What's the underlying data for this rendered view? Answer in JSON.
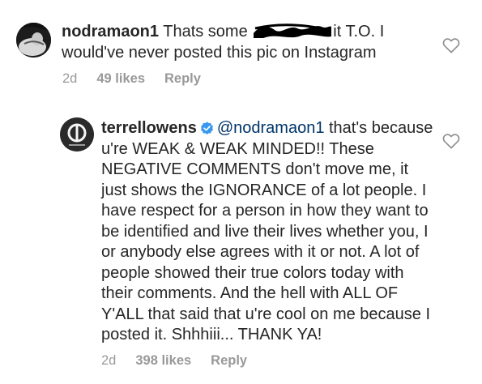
{
  "comments": [
    {
      "username": "nodramaon1",
      "text_before_redaction": "Thats some ",
      "text_after_redaction": "it T.O. I would've never posted this pic on Instagram",
      "time": "2d",
      "likes": "49 likes",
      "reply_label": "Reply",
      "like_icon": "heart-outline-icon"
    },
    {
      "username": "terrellowens",
      "verified": true,
      "verified_color": "#3897f0",
      "mention": "@nodramaon1",
      "text": " that's because u're WEAK & WEAK MINDED!! These NEGATIVE COMMENTS don't move me, it just shows the IGNORANCE of a lot people. I have respect for a person in how they want to be identified and live their lives whether you, I or anybody else agrees with it or not. A lot of people showed their true colors today with their comments. And the hell with ALL OF Y'ALL that said that u're cool on me because I posted it. Shhhiii... THANK YA!",
      "time": "2d",
      "likes": "398 likes",
      "reply_label": "Reply",
      "like_icon": "heart-outline-icon"
    }
  ],
  "colors": {
    "text": "#262626",
    "meta": "#999999",
    "mention": "#003569",
    "redaction": "#000000"
  }
}
